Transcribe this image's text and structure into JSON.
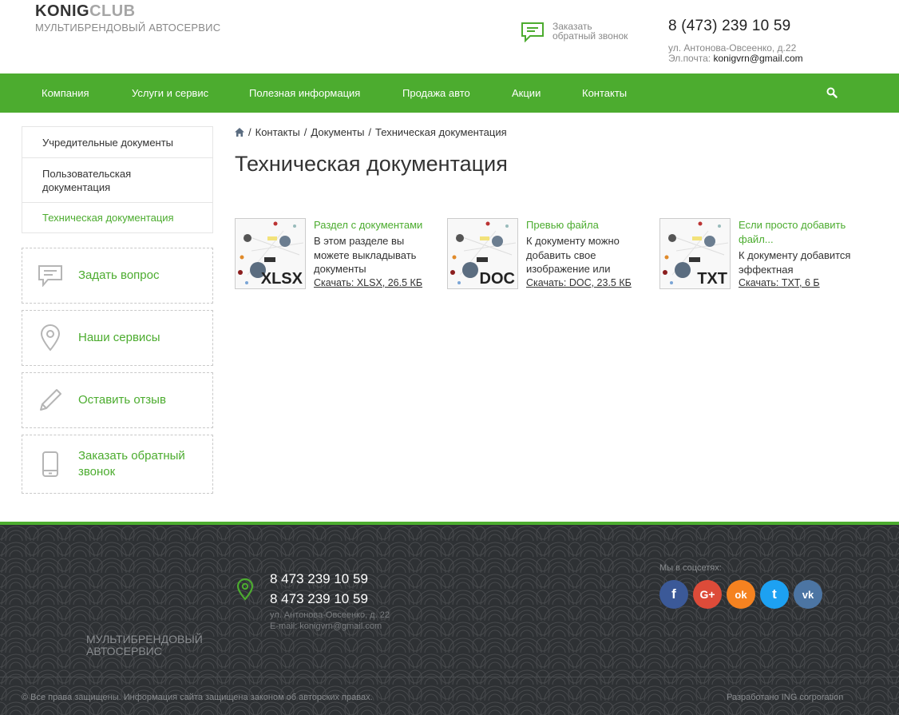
{
  "header": {
    "logo_bold": "KONIG",
    "logo_light": "CLUB",
    "logo_sub": "МУЛЬТИБРЕНДОВЫЙ АВТОСЕРВИС",
    "callback_line1": "Заказать",
    "callback_line2": "обратный звонок",
    "phone": "8 (473) 239 10 59",
    "address": "ул. Антонова-Овсеенко, д.22",
    "email_label": "Эл.почта:",
    "email": "konigvrn@gmail.com"
  },
  "nav": {
    "items": [
      "Компания",
      "Услуги и сервис",
      "Полезная информация",
      "Продажа авто",
      "Акции",
      "Контакты"
    ],
    "search_icon": "search-icon"
  },
  "sidebar": {
    "menu": [
      "Учредительные документы",
      "Пользовательская документация",
      "Техническая документация"
    ],
    "active_index": 2,
    "widgets": [
      {
        "label": "Задать вопрос",
        "icon": "chat-icon"
      },
      {
        "label": "Наши сервисы",
        "icon": "map-pin-icon"
      },
      {
        "label": "Оставить отзыв",
        "icon": "pencil-icon"
      },
      {
        "label": "Заказать обратный звонок",
        "icon": "phone-icon"
      }
    ]
  },
  "breadcrumb": {
    "home_icon": "home-icon",
    "items": [
      "Контакты",
      "Документы",
      "Техническая документация"
    ]
  },
  "page_title": "Техническая документация",
  "documents": [
    {
      "ext": "XLSX",
      "title": "Раздел с документами",
      "desc": "В этом разделе вы можете выкладывать документы",
      "link": "Скачать: XLSX, 26.5 КБ"
    },
    {
      "ext": "DOC",
      "title": "Превью файла",
      "desc": "К документу можно добавить свое изображение или",
      "link": "Скачать: DOC, 23.5 КБ"
    },
    {
      "ext": "TXT",
      "title": "Если просто добавить файл...",
      "desc": "К документу добавится эффектная",
      "link": "Скачать: TXT, 6 Б"
    }
  ],
  "footer": {
    "sub": "МУЛЬТИБРЕНДОВЫЙ АВТОСЕРВИС",
    "phone1": "8 473 239 10 59",
    "phone2": "8 473 239 10 59",
    "address": "ул. Антонова-Овсеенко, д. 22",
    "email": "E-mail: konigvrn@gmail.com",
    "social_label": "Мы в соцсетях:",
    "socials": [
      {
        "name": "facebook",
        "glyph": "f",
        "color": "#3b5998"
      },
      {
        "name": "google-plus",
        "glyph": "G+",
        "color": "#dd4b39"
      },
      {
        "name": "odnoklassniki",
        "glyph": "ok",
        "color": "#f58220"
      },
      {
        "name": "twitter",
        "glyph": "t",
        "color": "#1da1f2"
      },
      {
        "name": "vkontakte",
        "glyph": "vk",
        "color": "#4c75a3"
      }
    ],
    "copyright": "© Все права защищены. Информация сайта защищена законом об авторских правах.",
    "developer": "Разработано ING corporation"
  },
  "colors": {
    "accent": "#4cac2f",
    "footer_bg": "#2e3134"
  }
}
